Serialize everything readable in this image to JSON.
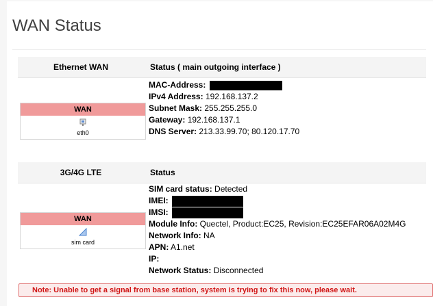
{
  "page": {
    "title": "WAN Status"
  },
  "ethernet": {
    "header_col1": "Ethernet WAN",
    "header_col2": "Status ( main outgoing interface )",
    "iface": {
      "name": "WAN",
      "device": "eth0",
      "icon": "ethernet-port-icon"
    },
    "fields": {
      "mac_label": "MAC-Address:",
      "ipv4_label": "IPv4 Address:",
      "ipv4_value": "192.168.137.2",
      "subnet_label": "Subnet Mask:",
      "subnet_value": "255.255.255.0",
      "gateway_label": "Gateway:",
      "gateway_value": "192.168.137.1",
      "dns_label": "DNS Server:",
      "dns_value": "213.33.99.70; 80.120.17.70"
    }
  },
  "lte": {
    "header_col1": "3G/4G LTE",
    "header_col2": "Status",
    "iface": {
      "name": "WAN",
      "device": "sim card",
      "icon": "signal-bars-icon"
    },
    "fields": {
      "sim_label": "SIM card status:",
      "sim_value": "Detected",
      "imei_label": "IMEI:",
      "imsi_label": "IMSI:",
      "module_label": "Module Info:",
      "module_value": "Quectel, Product:EC25, Revision:EC25EFAR06A02M4G",
      "network_label": "Network Info:",
      "network_value": "NA",
      "apn_label": "APN:",
      "apn_value": "A1.net",
      "ip_label": "IP:",
      "netstatus_label": "Network Status:",
      "netstatus_value": "Disconnected"
    }
  },
  "note": {
    "text": "Note: Unable to get a signal from base station, system is trying to fix this now, please wait."
  },
  "colors": {
    "iface_header": "#f09a9a",
    "note_text": "#d01515",
    "note_border": "#e07070"
  }
}
